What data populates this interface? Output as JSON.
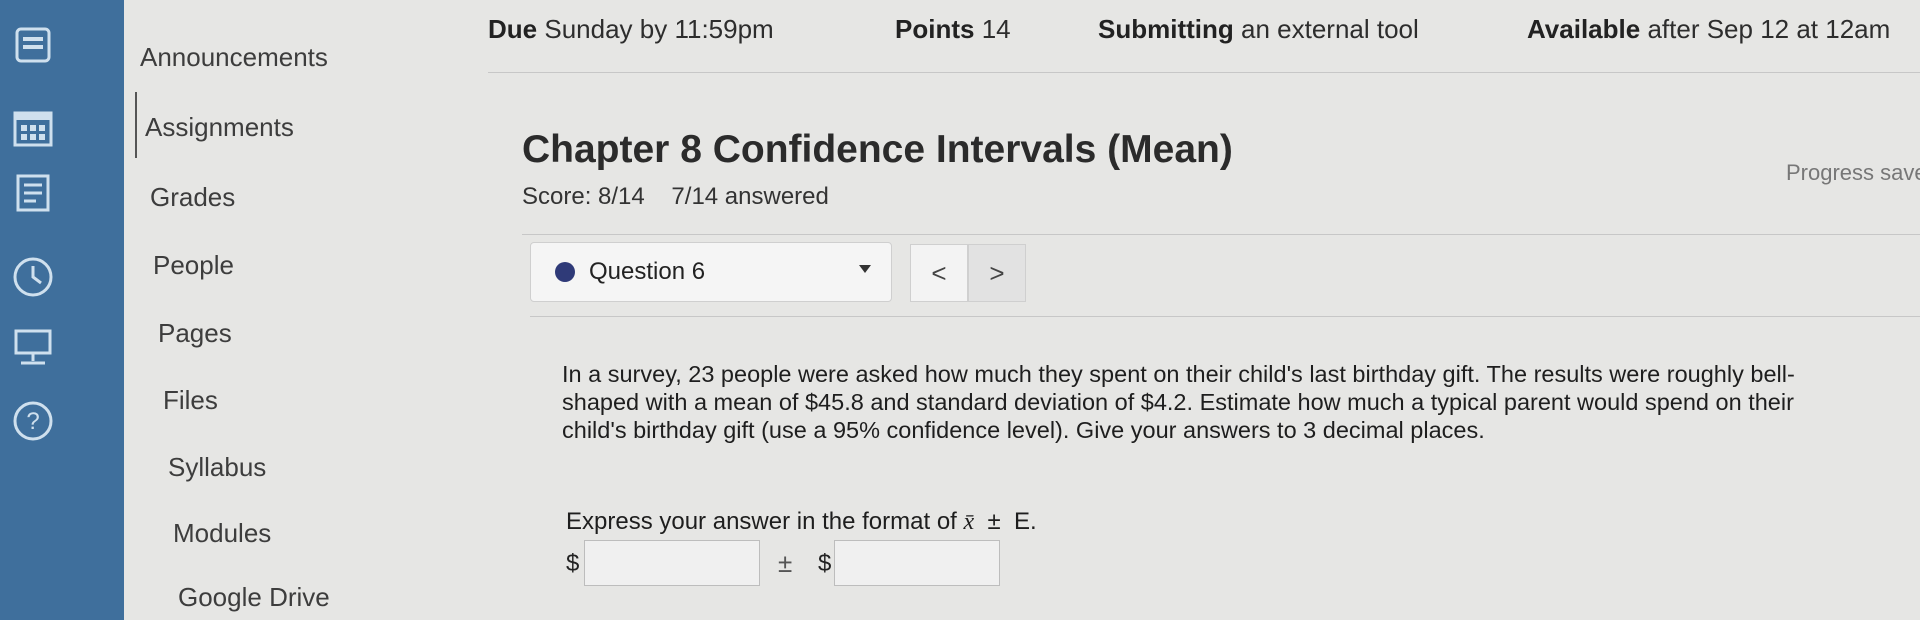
{
  "assignment_meta": {
    "due_label": "Due",
    "due_value": "Sunday by 11:59pm",
    "points_label": "Points",
    "points_value": "14",
    "submitting_label": "Submitting",
    "submitting_value": "an external tool",
    "available_label": "Available",
    "available_value": "after Sep 12 at 12am"
  },
  "course_nav": {
    "items": [
      "Announcements",
      "Assignments",
      "Grades",
      "People",
      "Pages",
      "Files",
      "Syllabus",
      "Modules",
      "Google Drive"
    ],
    "active": "Assignments"
  },
  "global_nav_icons": [
    "dashboard-icon",
    "calendar-icon",
    "inbox-icon",
    "history-icon",
    "commons-icon",
    "help-icon"
  ],
  "quiz": {
    "title": "Chapter 8 Confidence Intervals (Mean)",
    "score": "Score: 8/14",
    "answered": "7/14 answered",
    "progress": "Progress saved"
  },
  "question_nav": {
    "selected": "Question 6",
    "prev": "<",
    "next": ">"
  },
  "question": {
    "text": "In a survey, 23 people were asked how much they spent on their child's last birthday gift. The results were roughly bell-shaped with a mean of $45.8 and standard deviation of $4.2. Estimate how much a typical parent would spend on their child's birthday gift (use a 95% confidence level). Give your answers to 3 decimal places.",
    "format_prefix": "Express your answer in the format of",
    "format_xbar": "x̄",
    "format_pm": "±",
    "format_e": "E.",
    "currency": "$",
    "pm": "±",
    "mean_answer": "",
    "error_answer": ""
  },
  "colors": {
    "rail": "#3f6f9c",
    "question_dot": "#2f3a78"
  }
}
